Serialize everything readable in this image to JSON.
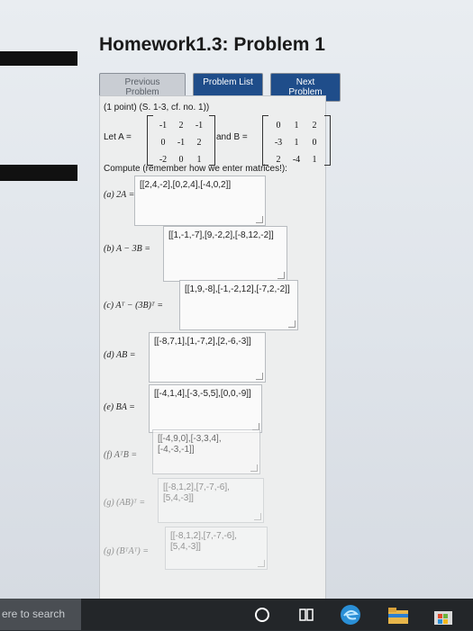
{
  "page": {
    "title": "Homework1.3: Problem 1"
  },
  "nav": {
    "previous": "Previous Problem",
    "list": "Problem List",
    "next": "Next Problem"
  },
  "problem": {
    "header": "(1 point) (S. 1-3, cf. no. 1))",
    "let_a": "Let A =",
    "and_b": "and B =",
    "matrix_a": [
      [
        "-1",
        "2",
        "-1"
      ],
      [
        "0",
        "-1",
        "2"
      ],
      [
        "-2",
        "0",
        "1"
      ]
    ],
    "matrix_b": [
      [
        "0",
        "1",
        "2"
      ],
      [
        "-3",
        "1",
        "0"
      ],
      [
        "2",
        "-4",
        "1"
      ]
    ],
    "instruction": "Compute (remember how we enter matrices!):",
    "parts": [
      {
        "label": "(a) 2A =",
        "answer": "[[2,4,-2],[0,2,4],[-4,0,2]]"
      },
      {
        "label": "(b) A − 3B =",
        "answer": "[[1,-1,-7],[9,-2,2],[-8,12,-2]]"
      },
      {
        "label": "(c) Aᵀ − (3B)ᵀ =",
        "answer": "[[1,9,-8],[-1,-2,12],[-7,2,-2]]"
      },
      {
        "label": "(d) AB =",
        "answer": "[[-8,7,1],[1,-7,2],[2,-6,-3]]"
      },
      {
        "label": "(e) BA =",
        "answer": "[[-4,1,4],[-3,-5,5],[0,0,-9]]"
      },
      {
        "label": "(f) AᵀB =",
        "answer": "[[-4,9,0],[-3,3,4],[-4,-3,-1]]"
      },
      {
        "label": "(g) (AB)ᵀ =",
        "answer": "[[-8,1,2],[7,-7,-6],[5,4,-3]]"
      },
      {
        "label": "(g) (BᵀAᵀ) =",
        "answer": "[[-8,1,2],[7,-7,-6],[5,4,-3]]"
      }
    ]
  },
  "taskbar": {
    "search_text": "ere to search"
  }
}
